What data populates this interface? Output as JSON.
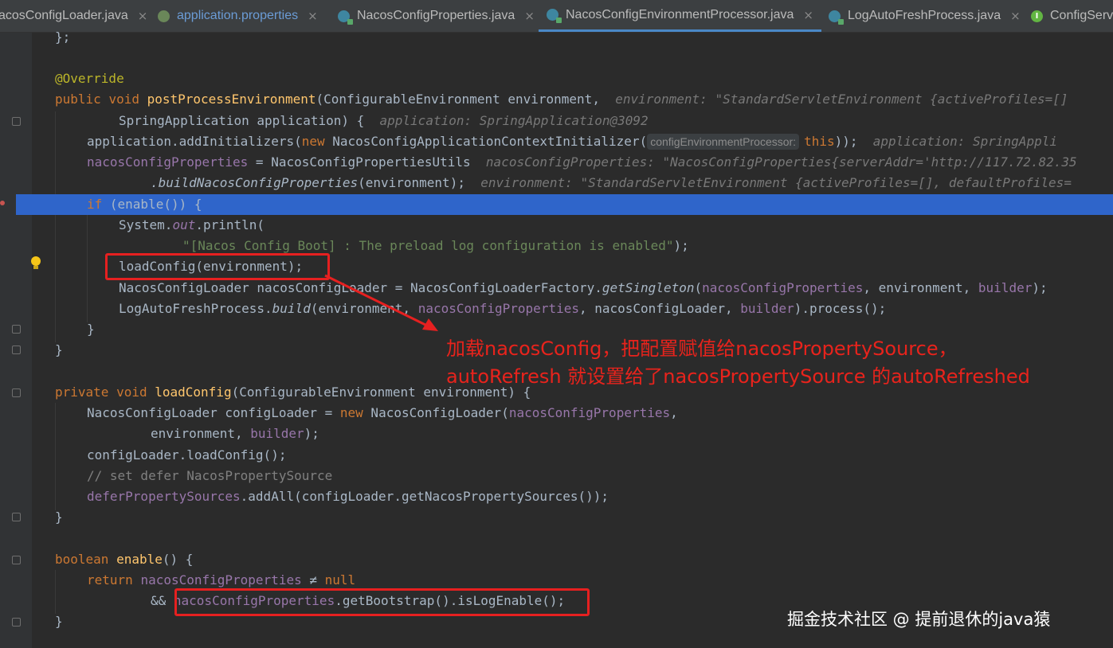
{
  "tabs": [
    {
      "label": "acosConfigLoader.java",
      "icon": "class-icon"
    },
    {
      "label": "application.properties",
      "icon": "properties-icon"
    },
    {
      "label": "NacosConfigProperties.java",
      "icon": "class-icon"
    },
    {
      "label": "NacosConfigEnvironmentProcessor.java",
      "icon": "class-icon",
      "active": true
    },
    {
      "label": "LogAutoFreshProcess.java",
      "icon": "class-icon"
    },
    {
      "label": "ConfigServ",
      "icon": "interface-icon"
    }
  ],
  "close_glyph": "×",
  "code": {
    "l1_close": "};",
    "override": "@Override",
    "kw_public": "public",
    "kw_void": "void",
    "m_post": "postProcessEnvironment",
    "p_open": "(ConfigurableEnvironment environment,",
    "h_env": "environment: \"StandardServletEnvironment {activeProfiles=[]",
    "p_app": "SpringApplication application) {",
    "h_app": "application: SpringApplication@3092",
    "add_init_a": "application.addInitializers(",
    "kw_new": "new",
    "add_init_b": " NacosConfigApplicationContextInitializer(",
    "param_label": "configEnvironmentProcessor:",
    "kw_this": "this",
    "add_init_c": "));",
    "h_app2": "application: SpringAppli",
    "ncp": "nacosConfigProperties",
    "ncp_assign": " = NacosConfigPropertiesUtils",
    "h_ncp": "nacosConfigProperties: \"NacosConfigProperties{serverAddr='http://117.72.82.35",
    "build_m": ".buildNacosConfigProperties",
    "build_args": "(environment);",
    "h_env2": "environment: \"StandardServletEnvironment {activeProfiles=[], defaultProfiles=",
    "kw_if": "if",
    "if_rest": " (enable()) {",
    "sysout_a": "System.",
    "sysout_out": "out",
    "sysout_b": ".println(",
    "preload_str": "\"[Nacos Config Boot] : The preload log configuration is enabled\"",
    "preload_end": ");",
    "load_call": "loadConfig(environment);",
    "loader_a": "NacosConfigLoader nacosConfigLoader = NacosConfigLoaderFactory.",
    "get_singleton": "getSingleton",
    "paren_open": "(",
    "comma": ", ",
    "environment": "environment",
    "builder": "builder",
    "loader_end": ");",
    "log_a": "LogAutoFreshProcess.",
    "log_build": "build",
    "log_b": "(environment, ",
    "log_c": "nacosConfigLoader, ",
    "log_d": ").process();",
    "brace_close": "}",
    "kw_private": "private",
    "m_load": "loadConfig",
    "load_params": "(ConfigurableEnvironment environment) {",
    "cl_a": "NacosConfigLoader configLoader = ",
    "cl_b": " NacosConfigLoader(",
    "comma_only": ",",
    "cl_env": "environment, ",
    "cl_end": ");",
    "cl_load": "configLoader.loadConfig();",
    "comment_defer": "// set defer NacosPropertySource",
    "defer": "deferPropertySources",
    "defer_rest": ".addAll(configLoader.getNacosPropertySources());",
    "kw_boolean": "boolean",
    "m_enable": "enable",
    "enable_rest": "() {",
    "kw_return": "return",
    "neq": "≠",
    "kw_null": "null",
    "and_op": "&&",
    "bootstrap_rest": ".getBootstrap().isLogEnable();"
  },
  "annotation": {
    "line1": "加载nacosConfig，把配置赋值给nacosPropertySource，",
    "line2": "autoRefresh 就设置给了nacosPropertySource 的autoRefreshed",
    "color": "#e8231c"
  },
  "watermark": "掘金技术社区 @ 提前退休的java猿",
  "colors": {
    "editor_bg": "#2b2b2b",
    "keyword": "#cc7832",
    "method_decl": "#ffc66d",
    "field": "#9876aa",
    "string": "#6a8759",
    "annotation": "#bbb529",
    "selection": "#2f65ca",
    "highlight_box": "#e62020"
  }
}
